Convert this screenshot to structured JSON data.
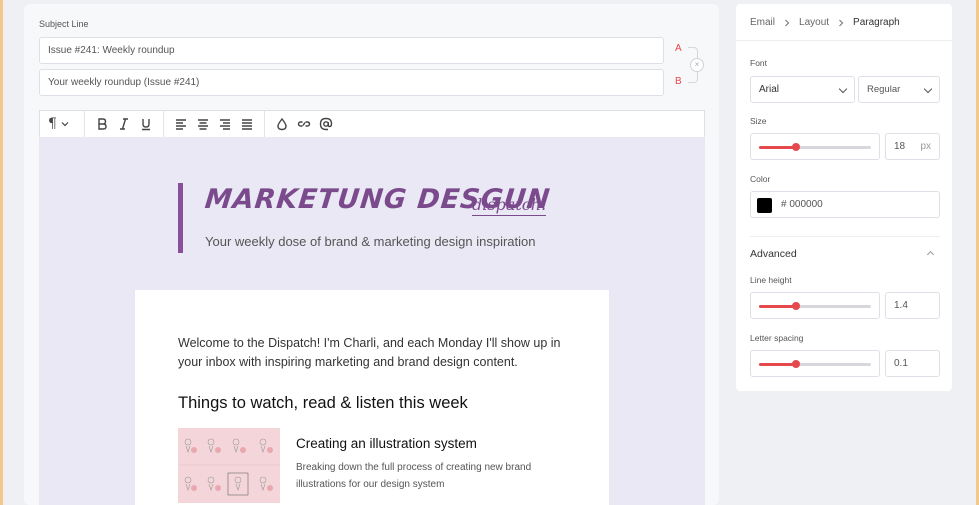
{
  "subject": {
    "title": "Subject Line",
    "variant_a_value": "Issue #241: Weekly roundup",
    "variant_b_value": "Your weekly roundup (Issue #241)",
    "label_a": "A",
    "label_b": "B",
    "swap_glyph": "×"
  },
  "toolbar": {
    "items": [
      "paragraph-icon",
      "chevron-down-icon",
      "bold-icon",
      "italic-icon",
      "underline-icon",
      "align-left-icon",
      "align-center-icon",
      "align-right-icon",
      "align-justify-icon",
      "drop-icon",
      "link-icon",
      "at-icon"
    ],
    "paragraph_glyph": "¶"
  },
  "email": {
    "brand_title": "MARKETUNG DESGUN",
    "brand_script": "dispatch.",
    "brand_tagline": "Your weekly dose of brand & marketing design inspiration",
    "welcome_text": "Welcome to the Dispatch! I'm Charli, and each Monday I'll show up in your inbox with inspiring marketing and brand design content.",
    "section_heading": "Things to watch, read & listen this week",
    "article_title": "Creating an illustration system",
    "article_desc": "Breaking down the full process of creating new brand illustrations for our design system",
    "accent_color": "#8a4f9a",
    "background_color": "#e9e8f4"
  },
  "props": {
    "breadcrumbs": [
      "Email",
      "Layout",
      "Paragraph"
    ],
    "font_label": "Font",
    "font_family_value": "Arial",
    "font_weight_value": "Regular",
    "size_label": "Size",
    "size_value": "18",
    "size_unit": "px",
    "size_slider_fraction": 0.33,
    "color_label": "Color",
    "color_value": "# 000000",
    "color_swatch": "#000000",
    "advanced_label": "Advanced",
    "line_height_label": "Line height",
    "line_height_value": "1.4",
    "line_height_slider_fraction": 0.33,
    "letter_spacing_label": "Letter spacing",
    "letter_spacing_value": "0.1",
    "letter_spacing_slider_fraction": 0.33,
    "accent_color": "#e5484d"
  }
}
